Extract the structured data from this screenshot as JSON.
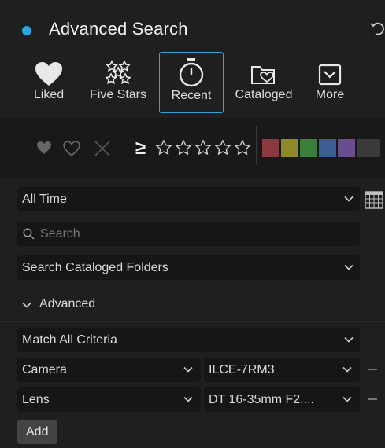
{
  "header": {
    "title": "Advanced Search",
    "accent": "#2aa7df",
    "undo_icon": "undo-icon"
  },
  "presets": [
    {
      "label": "Liked",
      "icon": "heart-icon"
    },
    {
      "label": "Five Stars",
      "icon": "five-stars-icon"
    },
    {
      "label": "Recent",
      "icon": "stopwatch-icon",
      "selected": true
    },
    {
      "label": "Cataloged",
      "icon": "folder-heart-icon"
    },
    {
      "label": "More",
      "icon": "chevron-down-box-icon"
    }
  ],
  "filters": {
    "flag_icons": [
      "heart-filled-icon",
      "heart-outline-icon",
      "reject-x-icon"
    ],
    "rating_operator": "≥",
    "star_count": 5,
    "color_labels": [
      "#8a3a3f",
      "#8f8a27",
      "#3b7f3b",
      "#3a5e93",
      "#6a4d8f",
      "#3a3a3a"
    ]
  },
  "time_select": {
    "value": "All Time",
    "calendar_icon": "calendar-icon"
  },
  "search": {
    "placeholder": "Search",
    "icon": "search-icon"
  },
  "scope_select": {
    "value": "Search Cataloged Folders"
  },
  "advanced": {
    "label": "Advanced",
    "match_select": {
      "value": "Match All Criteria"
    },
    "criteria": [
      {
        "field": "Camera",
        "value": "ILCE-7RM3"
      },
      {
        "field": "Lens",
        "value": "DT 16-35mm F2...."
      }
    ],
    "add_label": "Add"
  }
}
